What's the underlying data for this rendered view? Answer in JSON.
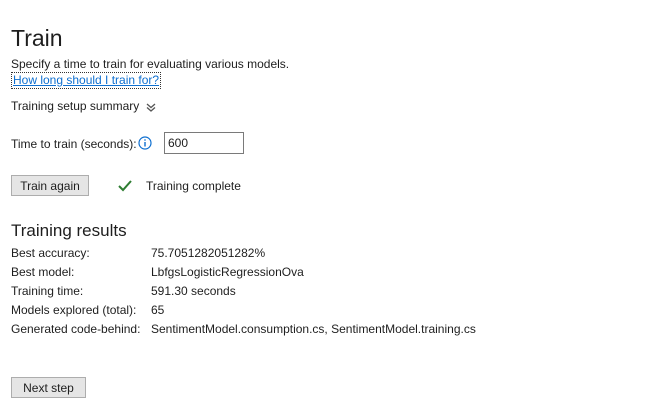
{
  "page": {
    "title": "Train",
    "subtitle": "Specify a time to train for evaluating various models.",
    "help_link": "How long should I train for?"
  },
  "setup_summary": {
    "label": "Training setup summary",
    "icon": "chevron-down-double-icon"
  },
  "time_to_train": {
    "label": "Time to train (seconds):",
    "info_icon": "info-icon",
    "value": "600"
  },
  "actions": {
    "train_again_label": "Train again",
    "next_step_label": "Next step"
  },
  "status": {
    "icon": "checkmark-icon",
    "text": "Training complete",
    "color": "#2e7d32"
  },
  "results": {
    "title": "Training results",
    "rows": [
      {
        "label": "Best accuracy:",
        "value": "75.7051282051282%"
      },
      {
        "label": "Best model:",
        "value": "LbfgsLogisticRegressionOva"
      },
      {
        "label": "Training time:",
        "value": "591.30 seconds"
      },
      {
        "label": "Models explored (total):",
        "value": "65"
      },
      {
        "label": "Generated code-behind:",
        "value": "SentimentModel.consumption.cs, SentimentModel.training.cs"
      }
    ]
  },
  "colors": {
    "link": "#0e6fd0",
    "info_icon": "#0e6fd0",
    "text": "#1e1e1e"
  }
}
